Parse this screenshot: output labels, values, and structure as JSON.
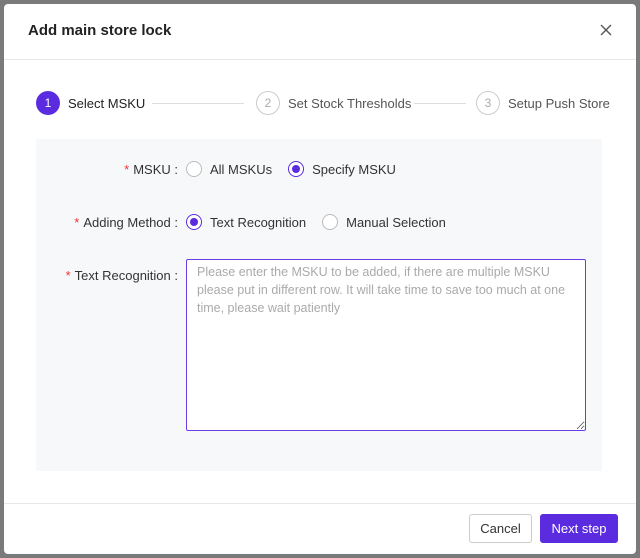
{
  "dialog": {
    "title": "Add main store lock",
    "close_icon": "close-icon"
  },
  "steps": [
    {
      "number": "1",
      "label": "Select MSKU",
      "state": "active"
    },
    {
      "number": "2",
      "label": "Set Stock Thresholds",
      "state": "inactive"
    },
    {
      "number": "3",
      "label": "Setup Push Store",
      "state": "inactive"
    }
  ],
  "form": {
    "msku": {
      "required_mark": "*",
      "label": "MSKU :",
      "options": [
        "All MSKUs",
        "Specify MSKU"
      ],
      "selected": "Specify MSKU"
    },
    "adding_method": {
      "required_mark": "*",
      "label": "Adding Method :",
      "options": [
        "Text Recognition",
        "Manual Selection"
      ],
      "selected": "Text Recognition"
    },
    "text_recognition": {
      "required_mark": "*",
      "label": "Text Recognition :",
      "value": "",
      "placeholder": "Please enter the MSKU to be added, if there are multiple MSKU please put in different row. It will take time to save too much at one time, please wait patiently"
    }
  },
  "footer": {
    "cancel_label": "Cancel",
    "next_label": "Next step"
  },
  "colors": {
    "accent": "#5b2be0",
    "required": "#e53935",
    "form_bg": "#f7f8fa"
  }
}
